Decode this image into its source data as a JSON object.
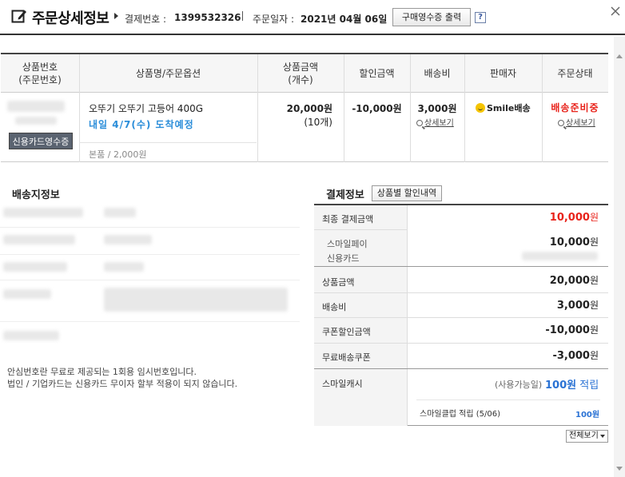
{
  "header": {
    "title": "주문상세정보",
    "payment_no_label": "결제번호 :",
    "payment_no": "1399532326",
    "order_date_label": "주문일자 :",
    "order_date": "2021년 04월 06일",
    "receipt_button": "구매영수증 출력",
    "help": "?"
  },
  "product_table": {
    "headers": [
      "상품번호\n(주문번호)",
      "상품명/주문옵션",
      "상품금액\n(개수)",
      "할인금액",
      "배송비",
      "판매자",
      "주문상태"
    ],
    "row": {
      "product_name": "오뚜기 오뚜기 고등어 400G",
      "delivery": "내일 4/7(수) 도착예정",
      "option": "본품 / 2,000원",
      "price": "20,000원",
      "qty": "(10개)",
      "discount": "-10,000원",
      "shipping": "3,000원",
      "shipping_detail": "상세보기",
      "seller": "Smile배송",
      "status": "배송준비중",
      "status_detail": "상세보기",
      "card_receipt_button": "신용카드영수증"
    }
  },
  "shipping_info": {
    "title": "배송지정보",
    "notice_line1": "안심번호란 무료로 제공되는 1회용 임시번호입니다.",
    "notice_line2": "법인 / 기업카드는 신용카드 무이자 할부 적용이 되지 않습니다."
  },
  "payment_info": {
    "title": "결제정보",
    "discount_button": "상품별 할인내역",
    "rows": {
      "final_label": "최종 결제금액",
      "final_amount": "10,000",
      "method_label1": "스마일페이",
      "method_label2": "신용카드",
      "method_amount": "10,000",
      "product_label": "상품금액",
      "product_amount": "20,000",
      "shipping_label": "배송비",
      "shipping_amount": "3,000",
      "coupon_label": "쿠폰할인금액",
      "coupon_amount": "-10,000",
      "free_ship_label": "무료배송쿠폰",
      "free_ship_amount": "-3,000",
      "cash_label": "스마일캐시",
      "cash_avail": "(사용가능일)",
      "cash_amount": "100원",
      "cash_earn": "적립",
      "club_label": "스마일클럽 적립 (5/06)",
      "club_amount": "100원"
    },
    "won": "원",
    "view_all": "전체보기"
  },
  "colors": {
    "accent_red": "#e8221a",
    "accent_blue": "#2a72d4",
    "delivery_blue": "#2a8dd9"
  }
}
